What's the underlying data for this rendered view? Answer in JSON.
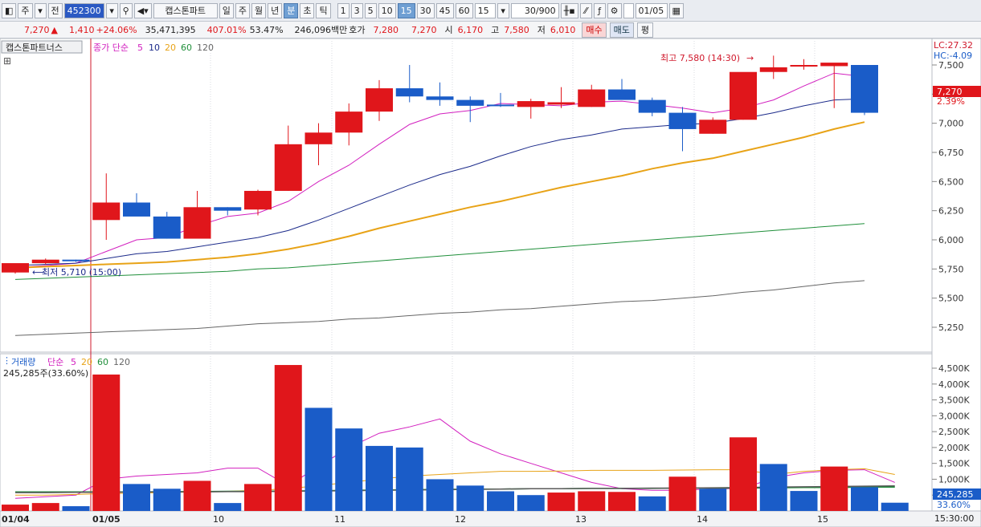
{
  "toolbar": {
    "market_type": "주",
    "search_mode": "전",
    "stock_code": "452300",
    "stock_name": "캡스톤파트",
    "period_buttons": [
      "일",
      "주",
      "월",
      "년",
      "분",
      "초",
      "틱"
    ],
    "active_period": "분",
    "interval_buttons": [
      "1",
      "3",
      "5",
      "10",
      "15",
      "30",
      "45",
      "60"
    ],
    "active_interval": "15",
    "interval_select": "15",
    "count": "30/900",
    "date": "01/05"
  },
  "info": {
    "price": "7,270",
    "change_arrow": "▲",
    "change": "1,410",
    "change_pct": "+24.06%",
    "volume": "35,471,395",
    "volume_ratio": "407.01%",
    "turnover": "53.47%",
    "amount": "246,096백만",
    "quote_label": "호가",
    "ask": "7,280",
    "bid": "7,270",
    "open_label": "시",
    "open": "6,170",
    "high_label": "고",
    "high": "7,580",
    "low_label": "저",
    "low": "6,010",
    "buy_label": "매수",
    "sell_label": "매도",
    "flat_label": "평"
  },
  "price_panel": {
    "stock_tag": "캡스톤파트너스",
    "ma_label": "종가 단순",
    "ma_periods": [
      "5",
      "10",
      "20",
      "60",
      "120"
    ],
    "ma_colors": [
      "#d21fbf",
      "#1b2a8a",
      "#e8a317",
      "#1f8f3a",
      "#666666"
    ],
    "high_annotation": "최고 7,580 (14:30)",
    "low_annotation": "최저 5,710 (15:00)",
    "lc": "LC:27.32",
    "hc": "HC:-4.09",
    "current_price_tag": "7,270",
    "current_pct_tag": "2.39%",
    "y_ticks": [
      "7,500",
      "7,250",
      "7,000",
      "6,750",
      "6,500",
      "6,250",
      "6,000",
      "5,750",
      "5,500",
      "5,250"
    ]
  },
  "volume_panel": {
    "label": "거래량",
    "ma_label": "단순",
    "ma_periods": [
      "5",
      "20",
      "60",
      "120"
    ],
    "value_text": "245,285주(33.60%)",
    "y_ticks": [
      "4,500K",
      "4,000K",
      "3,500K",
      "3,000K",
      "2,500K",
      "2,000K",
      "1,500K",
      "1,000K",
      "500K"
    ],
    "current_tag": "245,285",
    "current_pct_tag": "33.60%"
  },
  "x_axis": {
    "labels": [
      "01/04",
      "01/05",
      "10",
      "11",
      "12",
      "13",
      "14",
      "15"
    ],
    "time_label": "15:30:00"
  },
  "chart_data": {
    "type": "candlestick",
    "up_color": "#e0161b",
    "down_color": "#1a5cc8",
    "candles": [
      {
        "o": 5720,
        "h": 5770,
        "l": 5710,
        "c": 5800
      },
      {
        "o": 5800,
        "h": 5840,
        "l": 5790,
        "c": 5830
      },
      {
        "o": 5830,
        "h": 5830,
        "l": 5810,
        "c": 5820
      },
      {
        "o": 6170,
        "h": 6570,
        "l": 6000,
        "c": 6320
      },
      {
        "o": 6320,
        "h": 6400,
        "l": 6240,
        "c": 6200
      },
      {
        "o": 6200,
        "h": 6240,
        "l": 6010,
        "c": 6010
      },
      {
        "o": 6010,
        "h": 6420,
        "l": 6010,
        "c": 6280
      },
      {
        "o": 6280,
        "h": 6280,
        "l": 6210,
        "c": 6250
      },
      {
        "o": 6260,
        "h": 6430,
        "l": 6210,
        "c": 6420
      },
      {
        "o": 6420,
        "h": 6980,
        "l": 6420,
        "c": 6820
      },
      {
        "o": 6820,
        "h": 7000,
        "l": 6640,
        "c": 6920
      },
      {
        "o": 6920,
        "h": 7170,
        "l": 6810,
        "c": 7100
      },
      {
        "o": 7100,
        "h": 7370,
        "l": 7020,
        "c": 7300
      },
      {
        "o": 7300,
        "h": 7500,
        "l": 7180,
        "c": 7230
      },
      {
        "o": 7230,
        "h": 7350,
        "l": 7150,
        "c": 7200
      },
      {
        "o": 7200,
        "h": 7230,
        "l": 7010,
        "c": 7150
      },
      {
        "o": 7160,
        "h": 7260,
        "l": 7140,
        "c": 7150
      },
      {
        "o": 7140,
        "h": 7210,
        "l": 7040,
        "c": 7190
      },
      {
        "o": 7160,
        "h": 7310,
        "l": 7130,
        "c": 7180
      },
      {
        "o": 7140,
        "h": 7330,
        "l": 7140,
        "c": 7290
      },
      {
        "o": 7290,
        "h": 7380,
        "l": 7240,
        "c": 7200
      },
      {
        "o": 7200,
        "h": 7220,
        "l": 7060,
        "c": 7090
      },
      {
        "o": 7090,
        "h": 7140,
        "l": 6760,
        "c": 6950
      },
      {
        "o": 6910,
        "h": 7050,
        "l": 6910,
        "c": 7030
      },
      {
        "o": 7030,
        "h": 7430,
        "l": 7030,
        "c": 7440
      },
      {
        "o": 7440,
        "h": 7580,
        "l": 7380,
        "c": 7480
      },
      {
        "o": 7490,
        "h": 7550,
        "l": 7460,
        "c": 7500
      },
      {
        "o": 7490,
        "h": 7510,
        "l": 7130,
        "c": 7520
      },
      {
        "o": 7500,
        "h": 7500,
        "l": 7070,
        "c": 7090
      }
    ],
    "ma5": [
      5760,
      5780,
      5800,
      5900,
      6000,
      6020,
      6120,
      6200,
      6230,
      6330,
      6500,
      6640,
      6820,
      6990,
      7080,
      7110,
      7170,
      7160,
      7150,
      7180,
      7190,
      7160,
      7130,
      7090,
      7130,
      7200,
      7320,
      7430,
      7400
    ],
    "ma10": [
      5780,
      5790,
      5800,
      5840,
      5880,
      5900,
      5940,
      5980,
      6020,
      6080,
      6170,
      6270,
      6370,
      6470,
      6560,
      6630,
      6720,
      6800,
      6860,
      6900,
      6950,
      6970,
      6990,
      7000,
      7040,
      7090,
      7150,
      7200,
      7210
    ],
    "ma20": [
      5760,
      5770,
      5780,
      5790,
      5800,
      5810,
      5830,
      5850,
      5880,
      5920,
      5970,
      6030,
      6100,
      6160,
      6220,
      6280,
      6330,
      6390,
      6450,
      6500,
      6550,
      6610,
      6660,
      6700,
      6760,
      6820,
      6880,
      6950,
      7010
    ],
    "ma60": [
      5660,
      5670,
      5680,
      5690,
      5700,
      5710,
      5720,
      5730,
      5750,
      5760,
      5780,
      5800,
      5820,
      5840,
      5860,
      5880,
      5900,
      5920,
      5940,
      5960,
      5980,
      6000,
      6020,
      6040,
      6060,
      6080,
      6100,
      6120,
      6140
    ],
    "ma120": [
      5180,
      5190,
      5200,
      5210,
      5220,
      5230,
      5240,
      5260,
      5280,
      5290,
      5300,
      5320,
      5330,
      5350,
      5370,
      5380,
      5400,
      5410,
      5430,
      5450,
      5470,
      5480,
      5500,
      5520,
      5550,
      5570,
      5600,
      5630,
      5650
    ],
    "volume": [
      200,
      250,
      150,
      4300,
      850,
      700,
      950,
      250,
      850,
      4600,
      3250,
      2600,
      2050,
      2000,
      1000,
      800,
      620,
      500,
      580,
      620,
      600,
      460,
      1080,
      700,
      2320,
      1480,
      630,
      1400,
      750,
      260
    ],
    "volume_up": [
      true,
      true,
      false,
      true,
      false,
      false,
      true,
      false,
      true,
      true,
      false,
      false,
      false,
      false,
      false,
      false,
      false,
      false,
      true,
      true,
      true,
      false,
      true,
      false,
      true,
      false,
      false,
      true,
      false,
      false
    ],
    "vol_ma5": [
      400,
      450,
      500,
      1000,
      1100,
      1150,
      1200,
      1350,
      1350,
      800,
      1400,
      2000,
      2450,
      2650,
      2900,
      2200,
      1800,
      1500,
      1200,
      900,
      700,
      650,
      650,
      700,
      700,
      1050,
      1200,
      1280,
      1300,
      900
    ],
    "vol_ma20": [
      500,
      500,
      520,
      550,
      560,
      580,
      600,
      620,
      650,
      700,
      800,
      900,
      1000,
      1100,
      1150,
      1200,
      1250,
      1250,
      1260,
      1280,
      1280,
      1280,
      1290,
      1300,
      1300,
      1150,
      1250,
      1300,
      1330,
      1150
    ],
    "vol_ma60": [
      600,
      600,
      600,
      600,
      600,
      610,
      610,
      620,
      620,
      630,
      640,
      650,
      660,
      670,
      680,
      690,
      690,
      700,
      700,
      710,
      710,
      710,
      720,
      720,
      720,
      730,
      740,
      740,
      750,
      750
    ],
    "vol_ma120": [
      580,
      580,
      590,
      590,
      600,
      600,
      600,
      610,
      610,
      620,
      630,
      640,
      650,
      660,
      670,
      680,
      690,
      700,
      700,
      710,
      710,
      720,
      720,
      730,
      740,
      750,
      760,
      770,
      780,
      790
    ]
  }
}
